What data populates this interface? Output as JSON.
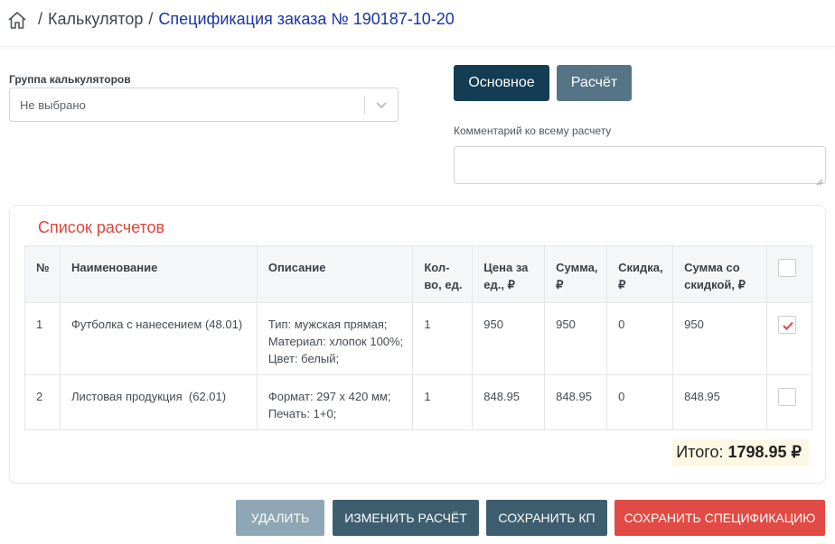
{
  "breadcrumb": {
    "home_icon": "home-icon",
    "separator": "/",
    "calculator": "Калькулятор",
    "current": "Спецификация заказа № 190187-10-20"
  },
  "group": {
    "label": "Группа калькуляторов",
    "value": "Не выбрано"
  },
  "tabs": {
    "main": "Основное",
    "calc": "Расчёт"
  },
  "comment": {
    "label": "Комментарий ко всему расчету",
    "value": ""
  },
  "calc_list": {
    "title": "Список расчетов",
    "headers": [
      "№",
      "Наименование",
      "Описание",
      "Кол-во, ед.",
      "Цена за ед., ₽",
      "Сумма, ₽",
      "Скидка, ₽",
      "Сумма со скидкой, ₽"
    ],
    "rows": [
      {
        "num": "1",
        "name": "Футболка с нанесением (48.01)",
        "description": [
          "Тип: мужская прямая;",
          "Материал: хлопок 100%;",
          "Цвет: белый;"
        ],
        "qty": "1",
        "price": "950",
        "sum": "950",
        "discount": "0",
        "sum_discount": "950",
        "checked": true
      },
      {
        "num": "2",
        "name": "Листовая продукция  (62.01)",
        "description": [
          "Формат: 297 х 420 мм;",
          "Печать: 1+0;"
        ],
        "qty": "1",
        "price": "848.95",
        "sum": "848.95",
        "discount": "0",
        "sum_discount": "848.95",
        "checked": false
      }
    ],
    "total_label": "Итого:",
    "total_value": "1798.95 ₽"
  },
  "actions": {
    "delete": "УДАЛИТЬ",
    "edit": "ИЗМЕНИТЬ РАСЧЁТ",
    "save_kp": "СОХРАНИТЬ КП",
    "save_spec": "СОХРАНИТЬ СПЕЦИФИКАЦИЮ"
  },
  "colors": {
    "link_blue": "#1a35a5",
    "title_red": "#e0453b",
    "primary_dark": "#143c55",
    "secondary": "#557587",
    "danger": "#e24b45",
    "check_red": "#e0453b"
  }
}
